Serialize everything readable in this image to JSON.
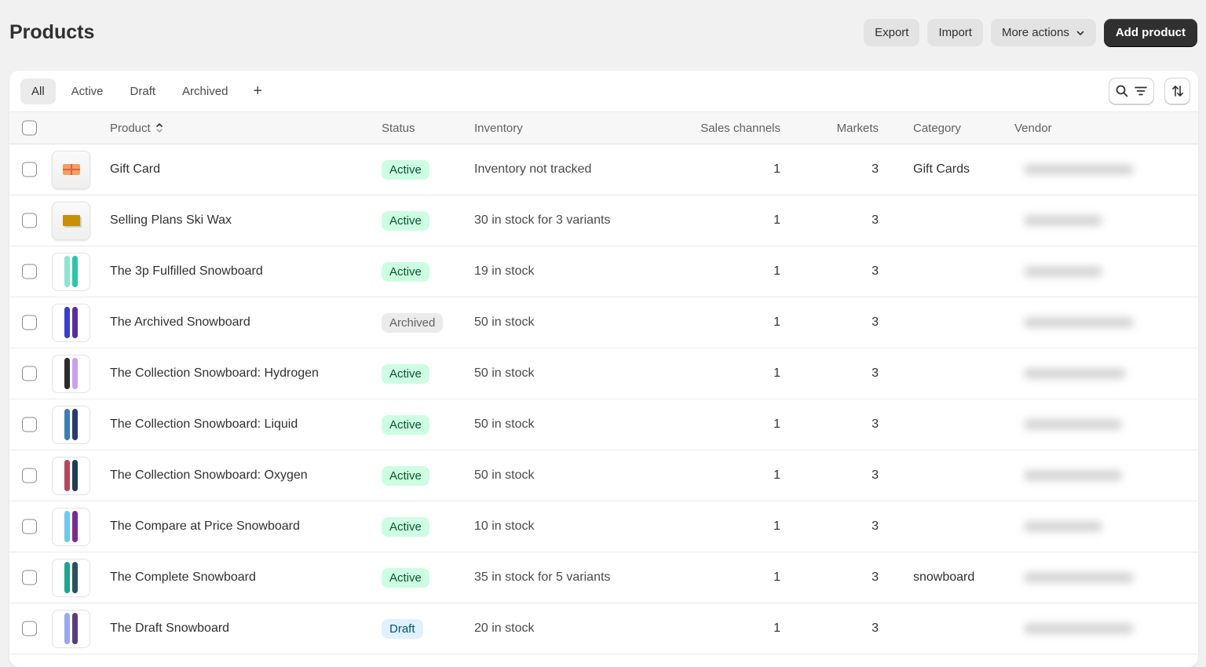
{
  "header": {
    "title": "Products",
    "actions": {
      "export": "Export",
      "import": "Import",
      "more_actions": "More actions",
      "add_product": "Add product"
    }
  },
  "tabs": [
    {
      "label": "All",
      "selected": true
    },
    {
      "label": "Active",
      "selected": false
    },
    {
      "label": "Draft",
      "selected": false
    },
    {
      "label": "Archived",
      "selected": false
    }
  ],
  "tab_add_label": "+",
  "toolbar": {
    "search_filter": "search-filter-icon",
    "sort": "sort-icon"
  },
  "columns": {
    "product": "Product",
    "status": "Status",
    "inventory": "Inventory",
    "sales_channels": "Sales channels",
    "markets": "Markets",
    "category": "Category",
    "vendor": "Vendor"
  },
  "status_colors": {
    "Active": {
      "bg": "#cdfee1",
      "fg": "#0c5132"
    },
    "Archived": {
      "bg": "#ebebeb",
      "fg": "#616161"
    },
    "Draft": {
      "bg": "#e0f0ff",
      "fg": "#00527c"
    }
  },
  "rows": [
    {
      "name": "Gift Card",
      "status": "Active",
      "inventory": "Inventory not tracked",
      "sales_channels": "1",
      "markets": "3",
      "category": "Gift Cards",
      "vendor_redacted": true,
      "thumb": {
        "type": "gift",
        "colors": [
          "#f0a060",
          "#e0604a"
        ]
      }
    },
    {
      "name": "Selling Plans Ski Wax",
      "status": "Active",
      "inventory": "30 in stock for 3 variants",
      "sales_channels": "1",
      "markets": "3",
      "category": "",
      "vendor_redacted": true,
      "thumb": {
        "type": "wax",
        "colors": [
          "#c8900a"
        ]
      }
    },
    {
      "name": "The 3p Fulfilled Snowboard",
      "status": "Active",
      "inventory": "19 in stock",
      "sales_channels": "1",
      "markets": "3",
      "category": "",
      "vendor_redacted": true,
      "thumb": {
        "type": "boards",
        "colors": [
          "#8ee6cf",
          "#2cc5a6"
        ]
      }
    },
    {
      "name": "The Archived Snowboard",
      "status": "Archived",
      "inventory": "50 in stock",
      "sales_channels": "1",
      "markets": "3",
      "category": "",
      "vendor_redacted": true,
      "thumb": {
        "type": "boards",
        "colors": [
          "#3a3fc7",
          "#5a2f9a"
        ]
      }
    },
    {
      "name": "The Collection Snowboard: Hydrogen",
      "status": "Active",
      "inventory": "50 in stock",
      "sales_channels": "1",
      "markets": "3",
      "category": "",
      "vendor_redacted": true,
      "thumb": {
        "type": "boards",
        "colors": [
          "#2b2b2b",
          "#c9a2ee"
        ]
      }
    },
    {
      "name": "The Collection Snowboard: Liquid",
      "status": "Active",
      "inventory": "50 in stock",
      "sales_channels": "1",
      "markets": "3",
      "category": "",
      "vendor_redacted": true,
      "thumb": {
        "type": "boards",
        "colors": [
          "#3d7eb0",
          "#2b3a6b"
        ]
      }
    },
    {
      "name": "The Collection Snowboard: Oxygen",
      "status": "Active",
      "inventory": "50 in stock",
      "sales_channels": "1",
      "markets": "3",
      "category": "",
      "vendor_redacted": true,
      "thumb": {
        "type": "boards",
        "colors": [
          "#b5475e",
          "#243a55"
        ]
      }
    },
    {
      "name": "The Compare at Price Snowboard",
      "status": "Active",
      "inventory": "10 in stock",
      "sales_channels": "1",
      "markets": "3",
      "category": "",
      "vendor_redacted": true,
      "thumb": {
        "type": "boards",
        "colors": [
          "#6fc9ea",
          "#7a2a8a"
        ]
      }
    },
    {
      "name": "The Complete Snowboard",
      "status": "Active",
      "inventory": "35 in stock for 5 variants",
      "sales_channels": "1",
      "markets": "3",
      "category": "snowboard",
      "vendor_redacted": true,
      "thumb": {
        "type": "boards",
        "colors": [
          "#1fa58f",
          "#2c5060"
        ]
      }
    },
    {
      "name": "The Draft Snowboard",
      "status": "Draft",
      "inventory": "20 in stock",
      "sales_channels": "1",
      "markets": "3",
      "category": "",
      "vendor_redacted": true,
      "thumb": {
        "type": "boards",
        "colors": [
          "#9aa8f0",
          "#5a3d7a"
        ]
      }
    }
  ]
}
